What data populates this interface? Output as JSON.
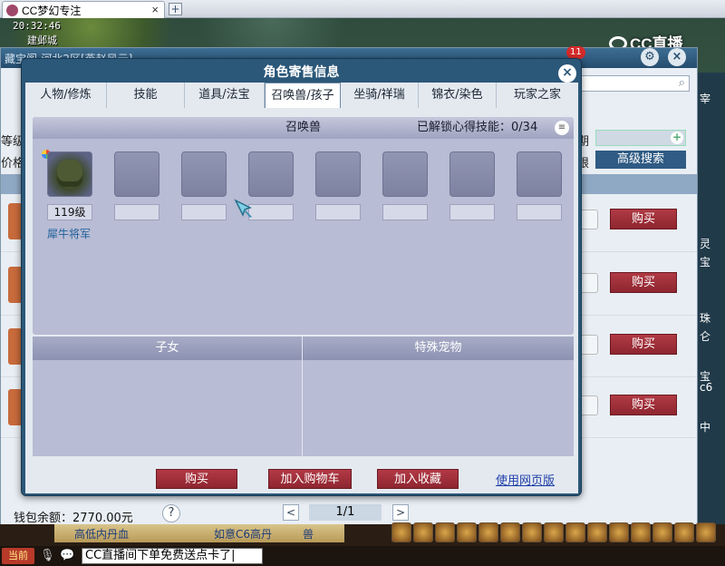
{
  "browser": {
    "tab_title": "CC梦幻专注",
    "tab_close": "×",
    "new_tab": "+"
  },
  "hud": {
    "clock": "20:32:46",
    "map_name": "建邺城",
    "stream_logo": "CC直播"
  },
  "shop": {
    "title": "藏宝阁-河北2区[燕赵风云]",
    "notification_count": "11",
    "icons": [
      "gear-icon",
      "close-icon"
    ],
    "left_labels": [
      "等级",
      "价格"
    ],
    "right_labels": [
      "期",
      "限"
    ],
    "advanced_search": "高级搜索",
    "buy_label": "购买",
    "wallet": "钱包余额：2770.00元",
    "help": "?",
    "prev": "<",
    "page": "1/1",
    "next": ">"
  },
  "dialog": {
    "title": "角色寄售信息",
    "close": "×",
    "tabs": [
      {
        "label": "人物/修炼"
      },
      {
        "label": "技能"
      },
      {
        "label": "道具/法宝"
      },
      {
        "label": "召唤兽/孩子"
      },
      {
        "label": "坐骑/祥瑞"
      },
      {
        "label": "锦衣/染色"
      },
      {
        "label": "玩家之家"
      }
    ],
    "active_tab": "召唤兽/孩子",
    "summon_header": "召唤兽",
    "unlocked_label": "已解锁心得技能：",
    "unlocked_value": "0/34",
    "pets": [
      {
        "level": "119级",
        "name": "犀牛将军"
      }
    ],
    "children_header": "子女",
    "special_pets_header": "特殊宠物",
    "buttons": {
      "buy": "购买",
      "add_to_cart": "加入购物车",
      "add_to_favorites": "加入收藏",
      "web_version": "使用网页版"
    }
  },
  "bottom": {
    "strip_items": [
      "高低内丹血",
      "如意C6高丹",
      "兽"
    ],
    "channel": "当前",
    "chat_input": "CC直播间下单免费送点卡了|"
  },
  "right_strip": [
    "宰",
    "灵",
    "宝",
    "珠",
    "仑",
    "宝",
    "c6",
    "中"
  ],
  "colors": {
    "dialog_frame": "#2b5778",
    "buy_red": "#9e2f39",
    "tab_bg": "#e4e9f0",
    "pet_panel": "#b8bcd4"
  }
}
